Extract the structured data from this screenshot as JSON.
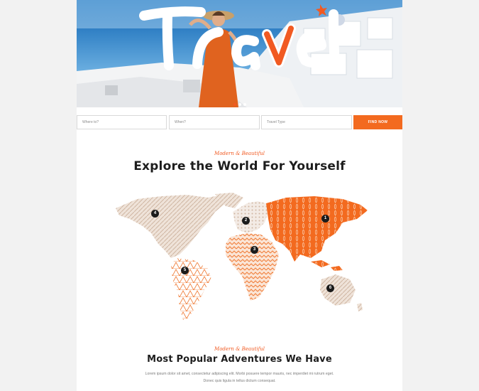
{
  "hero": {
    "title": "Travel",
    "slides": 3,
    "active_slide": 1
  },
  "search": {
    "where_placeholder": "Where to?",
    "when_placeholder": "When?",
    "type_placeholder": "Travel Type",
    "button_label": "FIND NOW"
  },
  "section_map": {
    "eyebrow": "Modern & Beautiful",
    "title": "Explore the World For Yourself",
    "markers": [
      "1",
      "2",
      "3",
      "4",
      "5",
      "6"
    ]
  },
  "section_adventures": {
    "eyebrow": "Modern & Beautiful",
    "title": "Most Popular Adventures We Have",
    "text_line1": "Lorem ipsum dolor sit amet, consectetur adipiscing elit. Morbi posuere tempor mauris, nec imperdiet mi rutrum eget.",
    "text_line2": "Donec quis ligula in tellus dictum consequat."
  },
  "colors": {
    "accent": "#f36a1f",
    "map_neutral": "#e7d8cc",
    "marker": "#1b1b1b"
  }
}
